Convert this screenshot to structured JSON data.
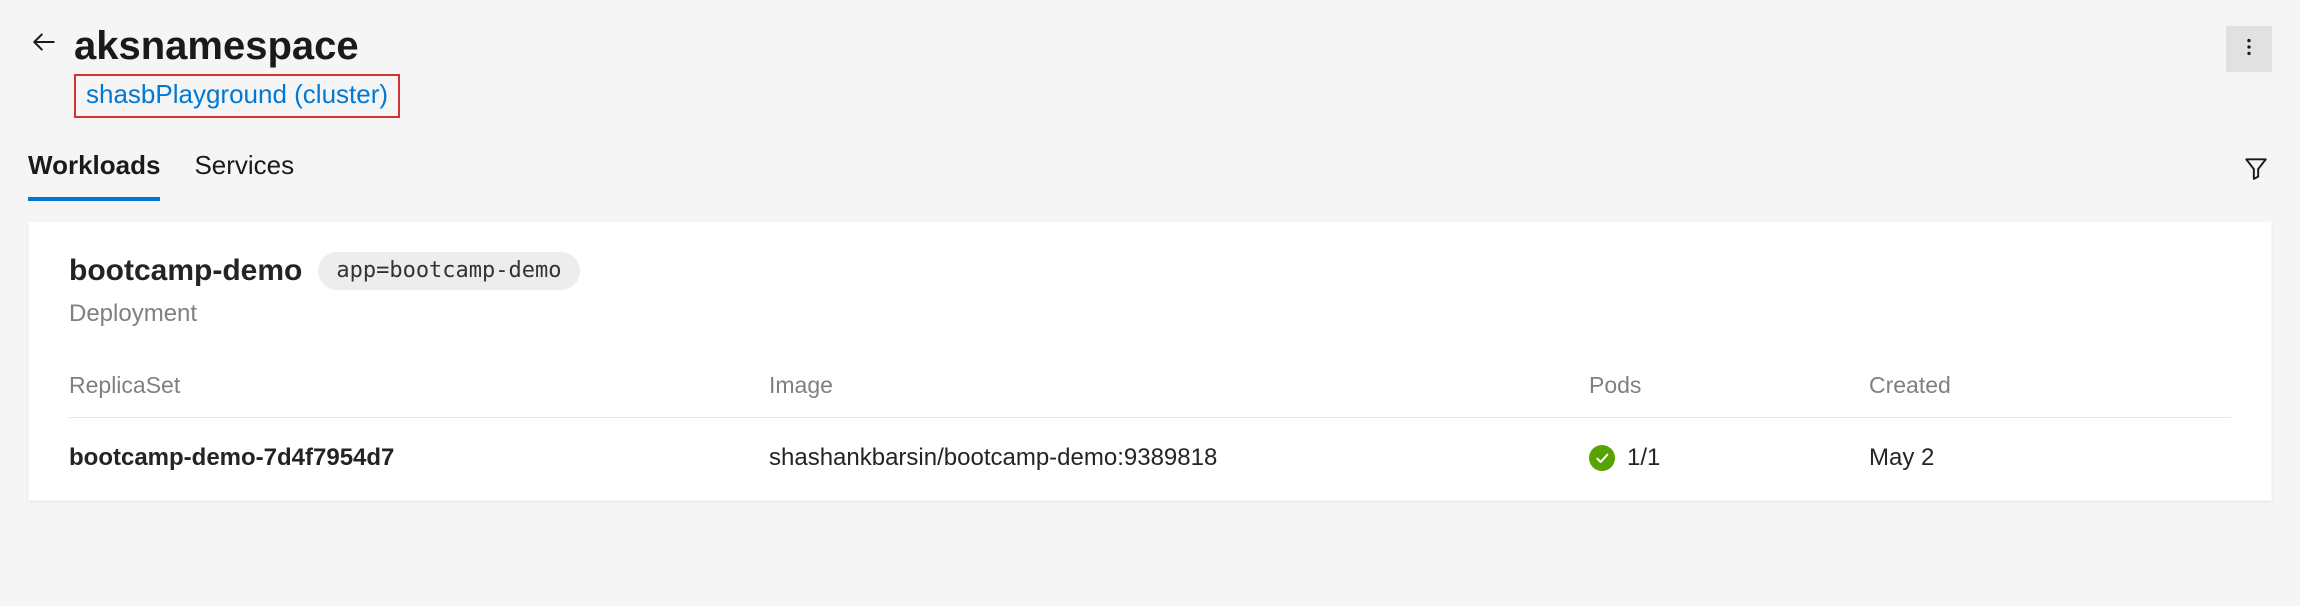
{
  "header": {
    "title": "aksnamespace",
    "cluster_link": "shasbPlayground (cluster)"
  },
  "tabs": [
    {
      "label": "Workloads",
      "active": true
    },
    {
      "label": "Services",
      "active": false
    }
  ],
  "card": {
    "name": "bootcamp-demo",
    "label_chip": "app=bootcamp-demo",
    "kind": "Deployment",
    "columns": {
      "replicaset": "ReplicaSet",
      "image": "Image",
      "pods": "Pods",
      "created": "Created"
    },
    "rows": [
      {
        "name": "bootcamp-demo-7d4f7954d7",
        "image": "shashankbarsin/bootcamp-demo:9389818",
        "pods": "1/1",
        "pods_ok": true,
        "created": "May 2"
      }
    ]
  }
}
